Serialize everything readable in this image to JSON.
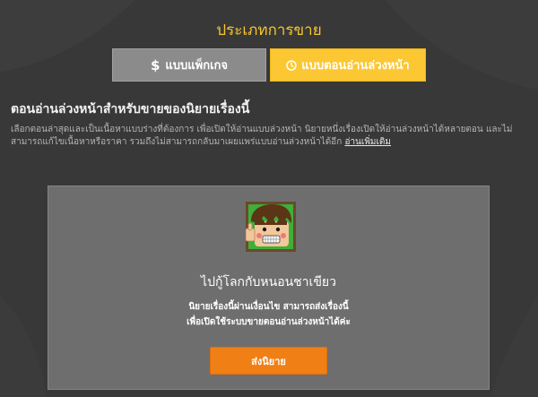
{
  "page": {
    "title": "ประเภทการขาย"
  },
  "sale_types": {
    "package_label": "แบบแพ็กเกจ",
    "package_icon": "dollar-icon",
    "advance_label": "แบบตอนอ่านล่วงหน้า",
    "advance_icon": "clock-icon",
    "active_color": "#fbc733",
    "inactive_color": "#8b8b8b"
  },
  "section": {
    "heading": "ตอนอ่านล่วงหน้าสำหรับขายของนิยายเรื่องนี้",
    "description_line1": "เลือกตอนล่าสุดและเป็นเนื้อหาแบบร่างที่ต้องการ เพื่อเปิดให้อ่านแบบล่วงหน้า นิยายหนึ่งเรื่องเปิดให้อ่านล่วงหน้าได้หลายตอน และไม่",
    "description_line2": "สามารถแก้ไขเนื้อหาหรือราคา รวมถึงไม่สามารถกลับมาเผยแพร่แบบอ่านล่วงหน้าได้อีก",
    "learn_more": "อ่านเพิ่มเติม"
  },
  "card": {
    "avatar_icon": "mascot-thumbs-up-icon",
    "novel_title": "ไปกู้โลกกับหนอนชาเขียว",
    "message_line1": "นิยายเรื่องนี้ผ่านเงื่อนไข สามารถส่งเรื่องนี้",
    "message_line2": "เพื่อเปิดใช้ระบบขายตอนอ่านล่วงหน้าได้ค่ะ",
    "send_button": "ส่งนิยาย",
    "send_color": "#f07f16"
  }
}
